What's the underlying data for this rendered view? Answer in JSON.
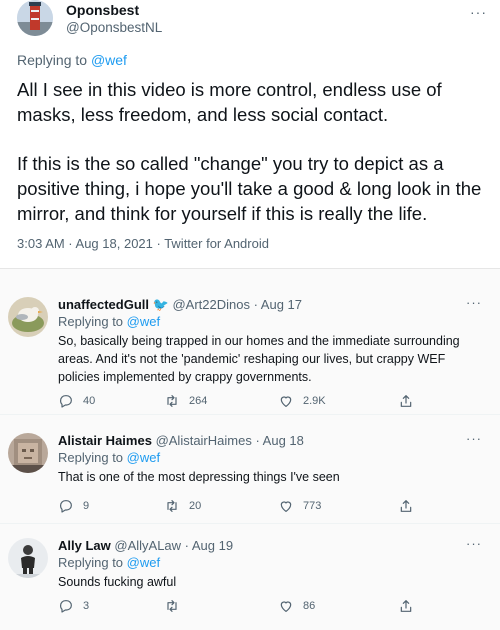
{
  "main_tweet": {
    "display_name": "Oponsbest",
    "handle": "@OponsbestNL",
    "more": "···",
    "replying_prefix": "Replying to",
    "replying_to": "@wef",
    "paragraph1": "All I see in this video is more control, endless use of masks, less freedom, and less social contact.",
    "paragraph2": "If this is the so called \"change\" you try to depict as a positive thing, i hope you'll take a good & long look in the mirror, and think for yourself if this is really the life.",
    "meta": "3:03 AM · Aug 18, 2021 · Twitter for Android"
  },
  "replies": [
    {
      "display_name": "unaffectedGull",
      "emoji": "🐦",
      "handle_date": "@Art22Dinos · Aug 17",
      "more": "···",
      "replying_prefix": "Replying to",
      "replying_to": "@wef",
      "text": "So, basically being trapped in our homes and the immediate surrounding areas. And it's not the 'pandemic' reshaping our lives, but crappy WEF policies implemented by crappy governments.",
      "replies": "40",
      "retweets": "264",
      "likes": "2.9K"
    },
    {
      "display_name": "Alistair Haimes",
      "handle_date": "@AlistairHaimes · Aug 18",
      "more": "···",
      "replying_prefix": "Replying to",
      "replying_to": "@wef",
      "text": "That is one of the most depressing things I've seen",
      "replies": "9",
      "retweets": "20",
      "likes": "773"
    },
    {
      "display_name": "Ally Law",
      "handle_date": "@AllyALaw · Aug 19",
      "more": "···",
      "replying_prefix": "Replying to",
      "replying_to": "@wef",
      "text": "Sounds fucking awful",
      "replies": "3",
      "retweets": "",
      "likes": "86"
    }
  ],
  "icons": {
    "reply": "comment-bubble-icon",
    "retweet": "retweet-arrows-icon",
    "like": "heart-icon",
    "share": "share-upload-icon"
  },
  "colors": {
    "link": "#1d9bf0",
    "secondary_text": "#536471",
    "primary_text": "#0f1419",
    "gull_emoji": "#e0245e"
  }
}
